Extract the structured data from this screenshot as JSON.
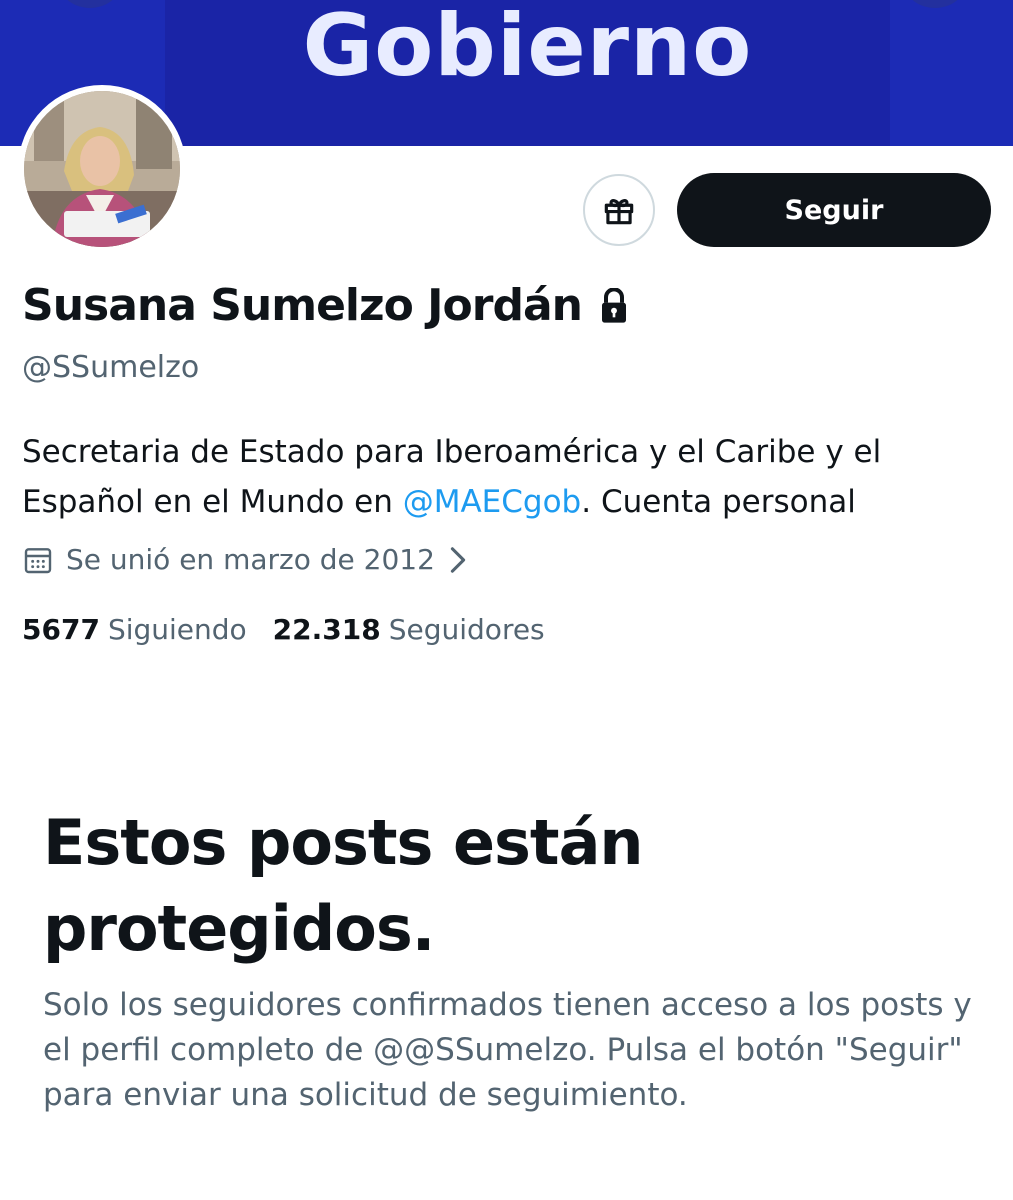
{
  "banner": {
    "text": "Gobierno",
    "color": "#1c2bb5"
  },
  "profile": {
    "display_name": "Susana Sumelzo Jordán",
    "handle": "@SSumelzo",
    "bio_before": "Secretaria de Estado para Iberoamérica y el Caribe y el Español en el Mundo en ",
    "bio_mention": "@MAECgob",
    "bio_after": ". Cuenta personal",
    "joined": "Se unió en marzo de 2012",
    "following_count": "5677",
    "following_label": "Siguiendo",
    "followers_count": "22.318",
    "followers_label": "Seguidores"
  },
  "actions": {
    "gift_icon": "gift-icon",
    "follow_label": "Seguir"
  },
  "protected": {
    "title": "Estos posts están protegidos.",
    "text": "Solo los seguidores confirmados tienen acceso a los posts y el perfil completo de @@SSumelzo. Pulsa el botón \"Seguir\" para enviar una solicitud de seguimiento."
  },
  "colors": {
    "accent": "#1d9bf0",
    "primary_text": "#0f1419",
    "secondary_text": "#536471"
  }
}
